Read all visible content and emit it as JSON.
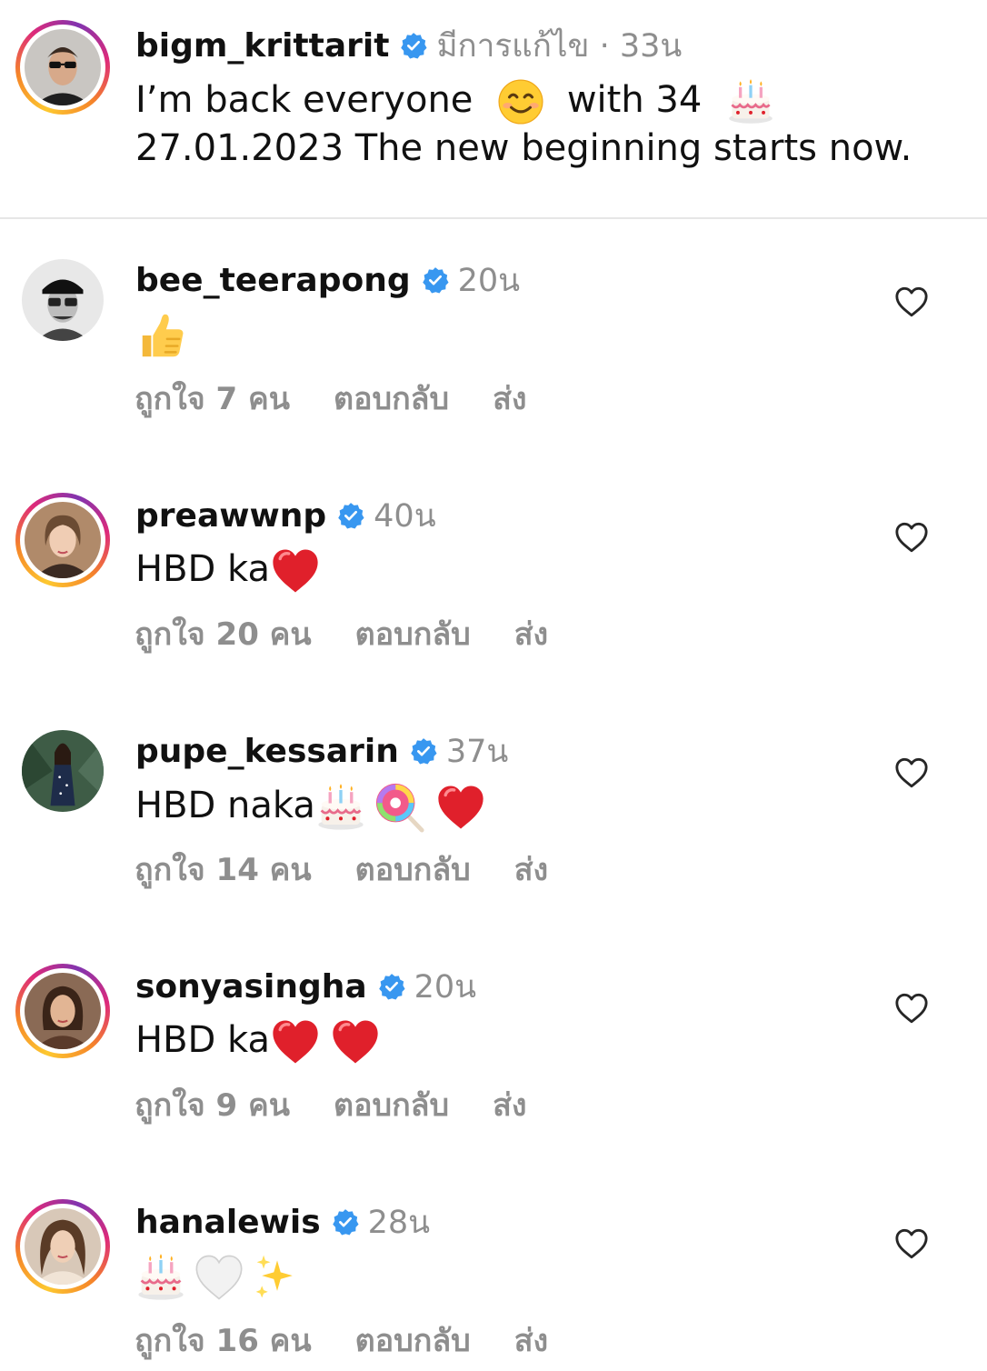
{
  "caption": {
    "username": "bigm_krittarit",
    "edited_label": "มีการแก้ไข · 33น",
    "line1_a": "I’m back everyone",
    "line1_b": "with 34",
    "line2": "27.01.2023 The new beginning starts now."
  },
  "comments": [
    {
      "username": "bee_teerapong",
      "time": "20น",
      "text": "",
      "emojis": [
        "thumbs-up"
      ],
      "likes": "ถูกใจ 7 คน",
      "reply": "ตอบกลับ",
      "send": "ส่ง"
    },
    {
      "username": "preawwnp",
      "time": "40น",
      "text": "HBD ka",
      "emojis": [
        "red-heart"
      ],
      "likes": "ถูกใจ 20 คน",
      "reply": "ตอบกลับ",
      "send": "ส่ง"
    },
    {
      "username": "pupe_kessarin",
      "time": "37น",
      "text": "HBD naka",
      "emojis": [
        "birthday-cake",
        "lollipop",
        "red-heart"
      ],
      "likes": "ถูกใจ 14 คน",
      "reply": "ตอบกลับ",
      "send": "ส่ง"
    },
    {
      "username": "sonyasingha",
      "time": "20น",
      "text": "HBD ka",
      "emojis": [
        "red-heart",
        "red-heart"
      ],
      "likes": "ถูกใจ 9 คน",
      "reply": "ตอบกลับ",
      "send": "ส่ง"
    },
    {
      "username": "hanalewis",
      "time": "28น",
      "text": "",
      "emojis": [
        "birthday-cake",
        "white-heart",
        "sparkles"
      ],
      "likes": "ถูกใจ 16 คน",
      "reply": "ตอบกลับ",
      "send": "ส่ง"
    }
  ],
  "colors": {
    "verified": "#3897f0",
    "muted": "#8e8e8e",
    "text": "#111111",
    "divider": "#e6e6e6"
  },
  "icons": {
    "verified": "verified-badge-icon",
    "like": "heart-outline-icon"
  }
}
